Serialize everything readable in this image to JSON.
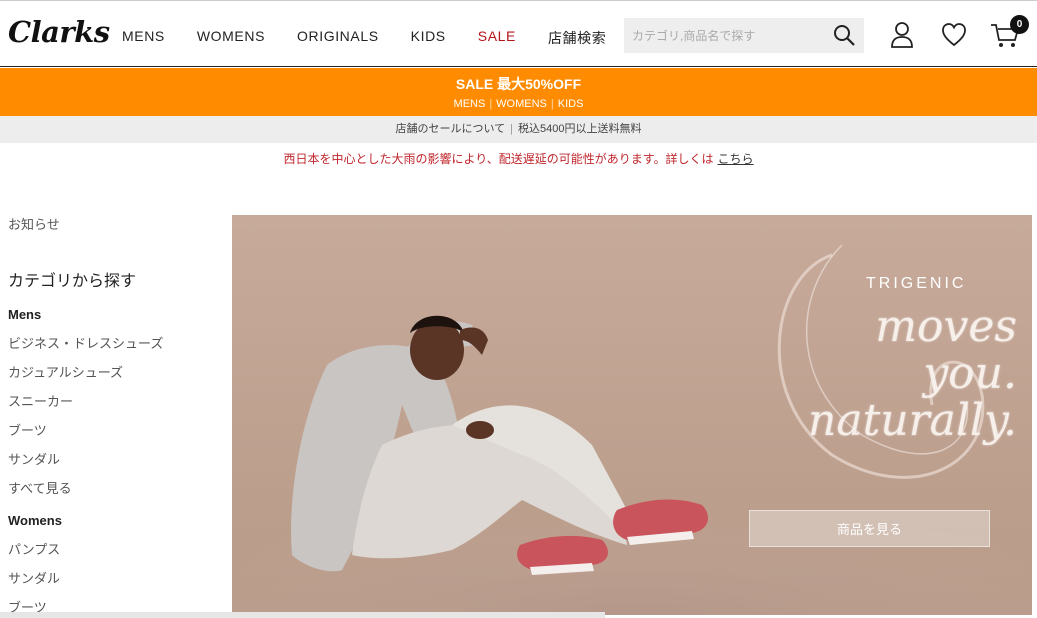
{
  "header": {
    "logo": "Clarks",
    "nav": [
      {
        "label": "MENS"
      },
      {
        "label": "WOMENS"
      },
      {
        "label": "ORIGINALS"
      },
      {
        "label": "KIDS"
      },
      {
        "label": "SALE"
      },
      {
        "label": "店舗検索"
      }
    ],
    "search": {
      "placeholder": "カテゴリ,商品名で探す"
    },
    "icons": [
      "search-icon",
      "user-icon",
      "heart-icon",
      "cart-icon"
    ],
    "cart_count": "0"
  },
  "promo": {
    "title": "SALE 最大50%OFF",
    "links": [
      "MENS",
      "WOMENS",
      "KIDS"
    ],
    "color": "#ff8c00"
  },
  "infobar": {
    "items": [
      "店舗のセールについて",
      "税込5400円以上送料無料"
    ]
  },
  "notice": {
    "text": "西日本を中心とした大雨の影響により、配送遅延の可能性があります。詳しくは",
    "link": "こちら",
    "color": "#c0272d"
  },
  "sidebar": {
    "news": "お知らせ",
    "category_title": "カテゴリから探す",
    "mens_title": "Mens",
    "mens_items": [
      "ビジネス・ドレスシューズ",
      "カジュアルシューズ",
      "スニーカー",
      "ブーツ",
      "サンダル",
      "すべて見る"
    ],
    "womens_title": "Womens",
    "womens_items": [
      "パンプス",
      "サンダル",
      "ブーツ"
    ]
  },
  "hero": {
    "brand": "TRIGENIC",
    "tagline": [
      "moves",
      "you.",
      "naturally."
    ],
    "cta": "商品を見る"
  }
}
